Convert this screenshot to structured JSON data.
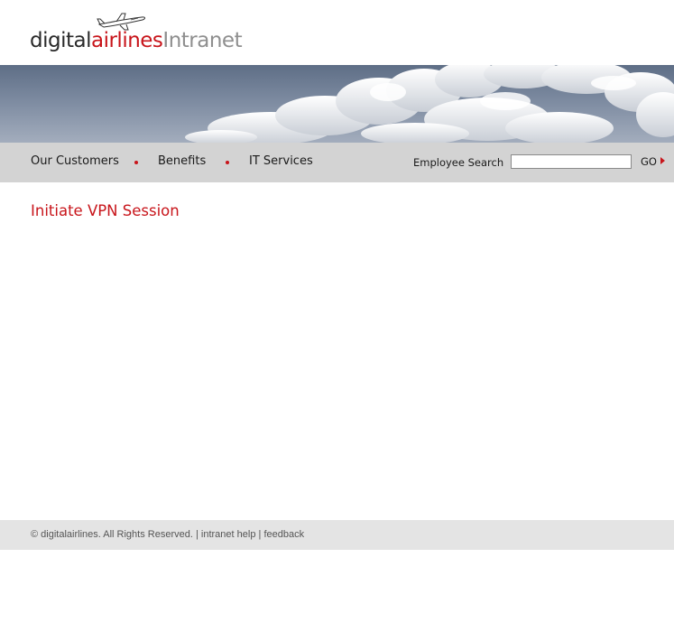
{
  "brand": {
    "part1": "digital",
    "part2": "airlines",
    "part3": "Intranet",
    "colors": {
      "dark": "#2a2a2a",
      "red": "#c8151b",
      "grey": "#8f8f8f"
    }
  },
  "nav": {
    "items": [
      {
        "label": "Our Customers"
      },
      {
        "label": "Benefits"
      },
      {
        "label": "IT Services"
      }
    ]
  },
  "search": {
    "label": "Employee Search",
    "value": "",
    "go_label": "GO"
  },
  "main": {
    "title": "Initiate VPN Session"
  },
  "footer": {
    "copyright_symbol": "©",
    "copyright": "digitalairlines.  All Rights Reserved.",
    "separator": "|",
    "help_link": "intranet help",
    "feedback_link": "feedback"
  }
}
